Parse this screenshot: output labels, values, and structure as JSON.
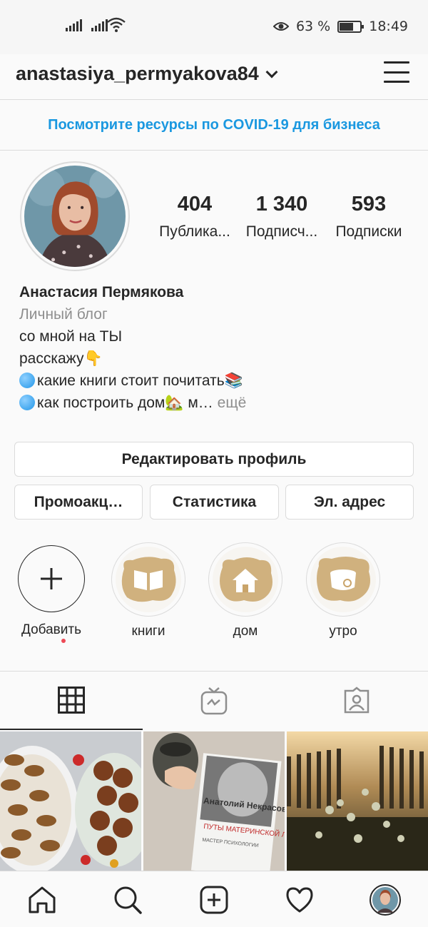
{
  "status_bar": {
    "battery_percent": "63 %",
    "time": "18:49",
    "battery_level": 0.63
  },
  "header": {
    "username": "anastasiya_permyakova84"
  },
  "banner": {
    "text": "Посмотрите ресурсы по COVID-19 для бизнеса"
  },
  "stats": [
    {
      "value": "404",
      "label": "Публика..."
    },
    {
      "value": "1 340",
      "label": "Подписч..."
    },
    {
      "value": "593",
      "label": "Подписки"
    }
  ],
  "bio": {
    "name": "Анастасия Пермякова",
    "category": "Личный блог",
    "line1": "со мной на ТЫ",
    "line2": "расскажу",
    "line3": "какие книги стоит почитать",
    "line4": "как построить дом",
    "line4_tail": " м…",
    "more": " ещё"
  },
  "buttons": {
    "edit_profile": "Редактировать профиль",
    "promotions": "Промоакц…",
    "insights": "Статистика",
    "email": "Эл. адрес"
  },
  "highlights": [
    {
      "label": "Добавить",
      "icon": "plus-icon"
    },
    {
      "label": "книги",
      "icon": "book-icon"
    },
    {
      "label": "дом",
      "icon": "house-icon"
    },
    {
      "label": "утро",
      "icon": "cup-icon"
    }
  ],
  "tabs": [
    {
      "name": "grid",
      "icon": "grid-icon",
      "active": true
    },
    {
      "name": "igtv",
      "icon": "igtv-icon",
      "active": false
    },
    {
      "name": "tagged",
      "icon": "tagged-icon",
      "active": false
    }
  ],
  "posts": [
    {
      "alt": "cookies-photo"
    },
    {
      "alt": "book-photo",
      "book_author": "Анатолий Некрасов",
      "book_title": "ПУТЫ МАТЕРИНСКОЙ ЛЮБВИ",
      "book_series": "МАСТЕР ПСИХОЛОГИИ"
    },
    {
      "alt": "flowers-sunset-photo"
    }
  ],
  "nav": [
    "home-icon",
    "search-icon",
    "new-post-icon",
    "activity-icon",
    "profile-avatar"
  ],
  "colors": {
    "link_blue": "#1a98e0",
    "text": "#262626",
    "muted": "#8e8e8e",
    "border": "#dbdbdb",
    "notif_red": "#ed4956",
    "highlight_gold": "#c9a46a"
  }
}
